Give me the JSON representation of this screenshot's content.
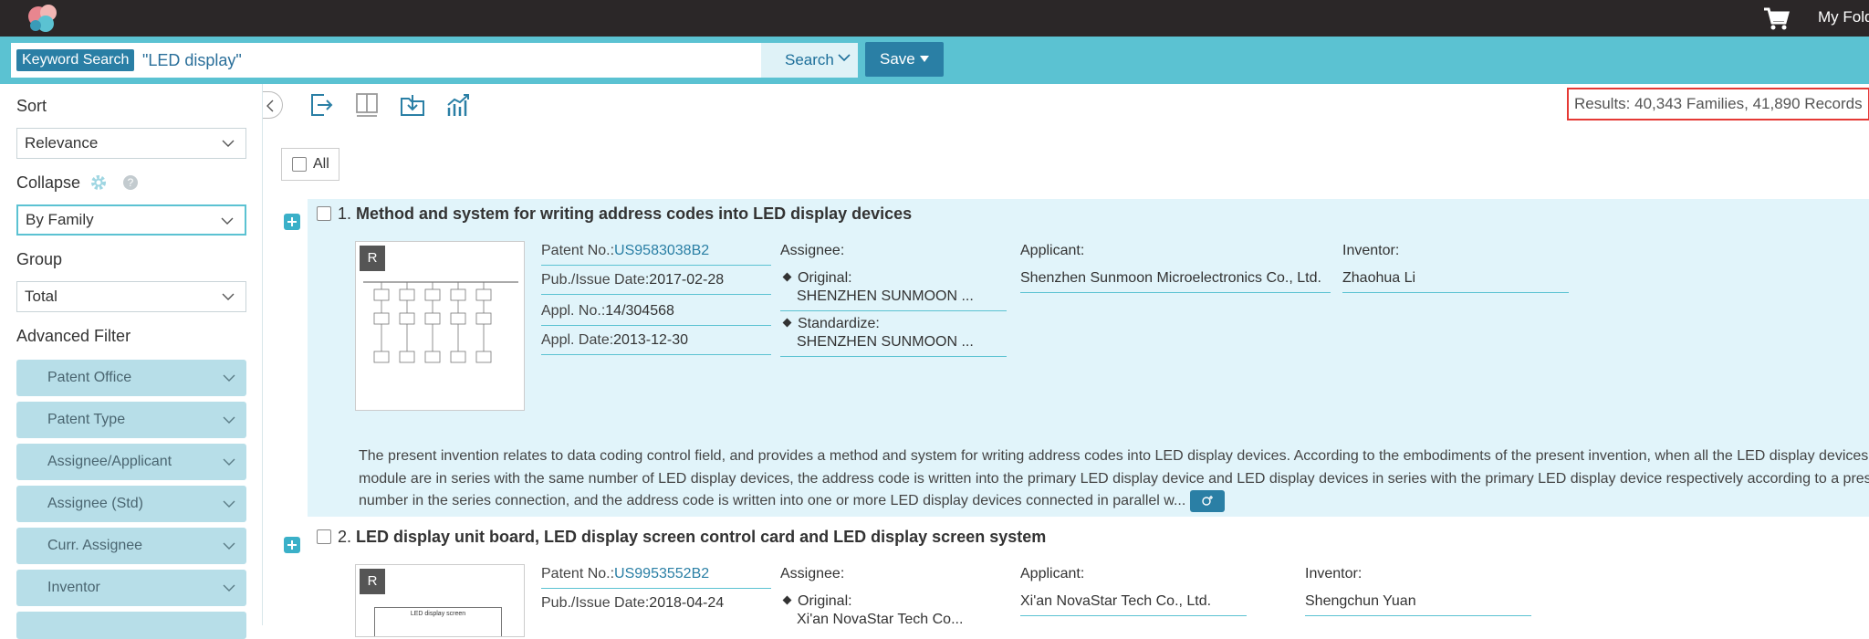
{
  "topbar": {
    "my_folder": "My Folder"
  },
  "search": {
    "tag": "Keyword Search",
    "query": "\"LED display\"",
    "search_label": "Search",
    "save_label": "Save"
  },
  "sidebar": {
    "sort_label": "Sort",
    "sort_value": "Relevance",
    "collapse_label": "Collapse",
    "collapse_value": "By Family",
    "group_label": "Group",
    "group_value": "Total",
    "advanced_label": "Advanced Filter",
    "filters": [
      "Patent Office",
      "Patent Type",
      "Assignee/Applicant",
      "Assignee (Std)",
      "Curr. Assignee",
      "Inventor"
    ]
  },
  "toolbar": {
    "results": "Results: 40,343 Families, 41,890 Records",
    "all_label": "All"
  },
  "records": [
    {
      "number": "1.",
      "title": "Method and system for writing address codes into LED display devices",
      "badge": "R",
      "patent_no_label": "Patent No.:",
      "patent_no": "US9583038B2",
      "pub_date_label": "Pub./Issue Date:",
      "pub_date": "2017-02-28",
      "appl_no_label": "Appl. No.:",
      "appl_no": "14/304568",
      "appl_date_label": "Appl. Date:",
      "appl_date": "2013-12-30",
      "assignee_label": "Assignee:",
      "original_label": "Original:",
      "original_value": "SHENZHEN SUNMOON ...",
      "standardize_label": "Standardize:",
      "standardize_value": "SHENZHEN SUNMOON ...",
      "applicant_label": "Applicant:",
      "applicant": "Shenzhen Sunmoon Microelectronics Co., Ltd.",
      "inventor_label": "Inventor:",
      "inventor": "Zhaohua Li",
      "abstract": "The present invention relates to data coding control field, and provides a method and system for writing address codes into LED display devices. According to the embodiments of the present invention, when all the LED display devices in the module are in series with the same number of LED display devices, the address code is written into the primary LED display device and LED display devices in series with the primary LED display device respectively according to a preset number in the series connection, and the address code is written into one or more LED display devices connected in parallel w..."
    },
    {
      "number": "2.",
      "title": "LED display unit board, LED display screen control card and LED display screen system",
      "badge": "R",
      "thumb_caption": "LED display screen",
      "patent_no_label": "Patent No.:",
      "patent_no": "US9953552B2",
      "pub_date_label": "Pub./Issue Date:",
      "pub_date": "2018-04-24",
      "assignee_label": "Assignee:",
      "original_label": "Original:",
      "original_value": "Xi'an NovaStar Tech Co...",
      "applicant_label": "Applicant:",
      "applicant": "Xi'an NovaStar Tech Co., Ltd.",
      "inventor_label": "Inventor:",
      "inventor": "Shengchun Yuan"
    }
  ],
  "colors": {
    "topbar": "#2b2728",
    "search_bar": "#5bc2d2",
    "accent": "#2a7fa5",
    "highlight_row": "#e1f4fa",
    "filter_bg": "#b7dee8",
    "results_border": "#e53935"
  }
}
